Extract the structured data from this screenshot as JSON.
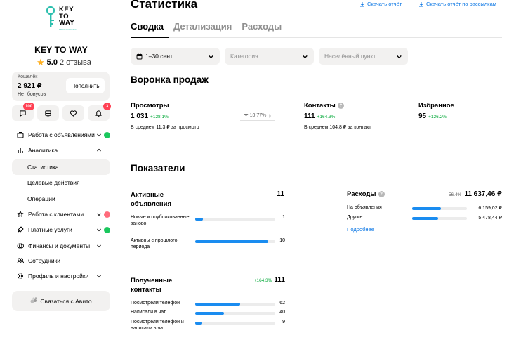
{
  "sidebar": {
    "logo_text": [
      "KEY",
      "TO",
      "WAY"
    ],
    "logo_sub": "TRAVEL AGENCY",
    "shop_name": "KEY TO WAY",
    "rating": "5.0",
    "reviews": "2 отзыва",
    "wallet": {
      "label": "Кошелёк",
      "amount": "2 921 ₽",
      "bonus": "Нет бонусов",
      "topup_label": "Пополнить"
    },
    "quick": [
      {
        "icon": "chat-icon",
        "badge": "100"
      },
      {
        "icon": "cart-icon",
        "badge": ""
      },
      {
        "icon": "heart-icon",
        "badge": ""
      },
      {
        "icon": "bell-icon",
        "badge": "3"
      }
    ],
    "nav": {
      "ads": "Работа с объявлениями",
      "analytics": "Аналитика",
      "stats": "Статистика",
      "targets": "Целевые действия",
      "operations": "Операции",
      "clients": "Работа с клиентами",
      "paid": "Платные услуги",
      "finance": "Финансы и документы",
      "staff": "Сотрудники",
      "profile": "Профиль и настройки"
    },
    "status_colors": {
      "green": "#1ac75d",
      "red": "#ff6b7b"
    },
    "contact_label": "Связаться с Авито"
  },
  "main": {
    "title": "Статистика",
    "download_report": "Скачать отчёт",
    "download_mailing": "Скачать отчёт по рассылкам",
    "tabs": [
      "Сводка",
      "Детализация",
      "Расходы"
    ],
    "filters": {
      "period": "1–30 сент",
      "category": "Категория",
      "city": "Населённый пункт"
    },
    "funnel": {
      "title": "Воронка продаж",
      "views": {
        "title": "Просмотры",
        "value": "1 031",
        "delta": "+128.1%",
        "note": "В среднем 11,3 ₽ за просмотр"
      },
      "conversion": "10,77%",
      "contacts": {
        "title": "Контакты",
        "value": "111",
        "delta": "+164.3%",
        "note": "В среднем 104,8 ₽ за контакт"
      },
      "favorites": {
        "title": "Избранное",
        "value": "95",
        "delta": "+126.2%"
      }
    },
    "indicators": {
      "title": "Показатели",
      "active": {
        "title": "Активные объявления",
        "value": "11",
        "rows": [
          {
            "label": "Новые и опубликованные заново",
            "value": "1",
            "fill": 0.1
          },
          {
            "label": "Активны с прошлого периода",
            "value": "10",
            "fill": 0.91
          }
        ]
      },
      "expenses": {
        "title": "Расходы",
        "delta": "-56.4%",
        "value": "11 637,46 ₽",
        "rows": [
          {
            "label": "На объявления",
            "value": "6 159,02 ₽",
            "fill": 0.53
          },
          {
            "label": "Другие",
            "value": "5 478,44 ₽",
            "fill": 0.47
          }
        ],
        "more": "Подробнее"
      },
      "contacts": {
        "title": "Полученные контакты",
        "delta": "+164.3%",
        "value": "111",
        "rows": [
          {
            "label": "Посмотрели телефон",
            "value": "62",
            "fill": 0.56
          },
          {
            "label": "Написали в чат",
            "value": "40",
            "fill": 0.36
          },
          {
            "label": "Посмотрели телефон и написали в чат",
            "value": "9",
            "fill": 0.08
          }
        ]
      }
    }
  },
  "colors": {
    "accent": "#0a76e4",
    "bar": "#1a8cf0",
    "positive": "#02a837",
    "badge": "#ff4053"
  }
}
